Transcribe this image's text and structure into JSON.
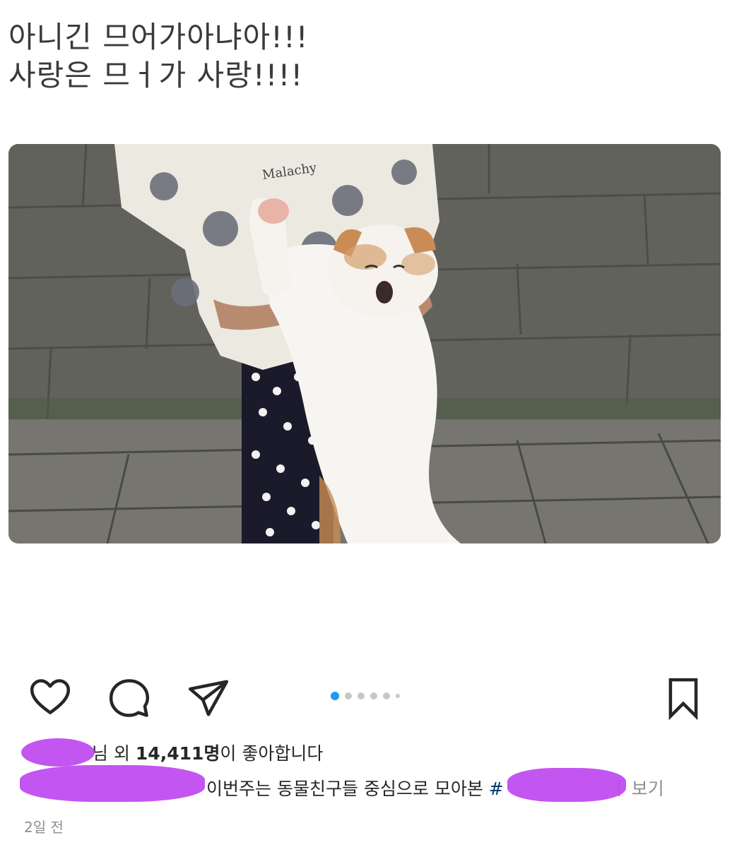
{
  "post": {
    "title_line1": "아니긴 므어가아냐아!!!",
    "title_line2": "사랑은 므ㅓ가 사랑!!!!"
  },
  "photo": {
    "shirt_print_text": "Malachy"
  },
  "actions": {
    "like_icon": "heart-icon",
    "comment_icon": "comment-icon",
    "share_icon": "paper-plane-icon",
    "save_icon": "bookmark-icon"
  },
  "carousel": {
    "total": 6,
    "active_index": 0
  },
  "likes": {
    "prefix": "님 외 ",
    "count": "14,411명",
    "suffix": "이 좋아합니다"
  },
  "caption": {
    "text": "이번주는 동물친구들 중심으로 모아본 ",
    "hashtag": "#",
    "more": "ㅓ 보기"
  },
  "timestamp": "2일 전",
  "colors": {
    "accent_blue": "#1d9bf0",
    "hashtag_blue": "#00376b",
    "redaction_purple": "#c04cf0",
    "muted_gray": "#8e8e8e"
  }
}
